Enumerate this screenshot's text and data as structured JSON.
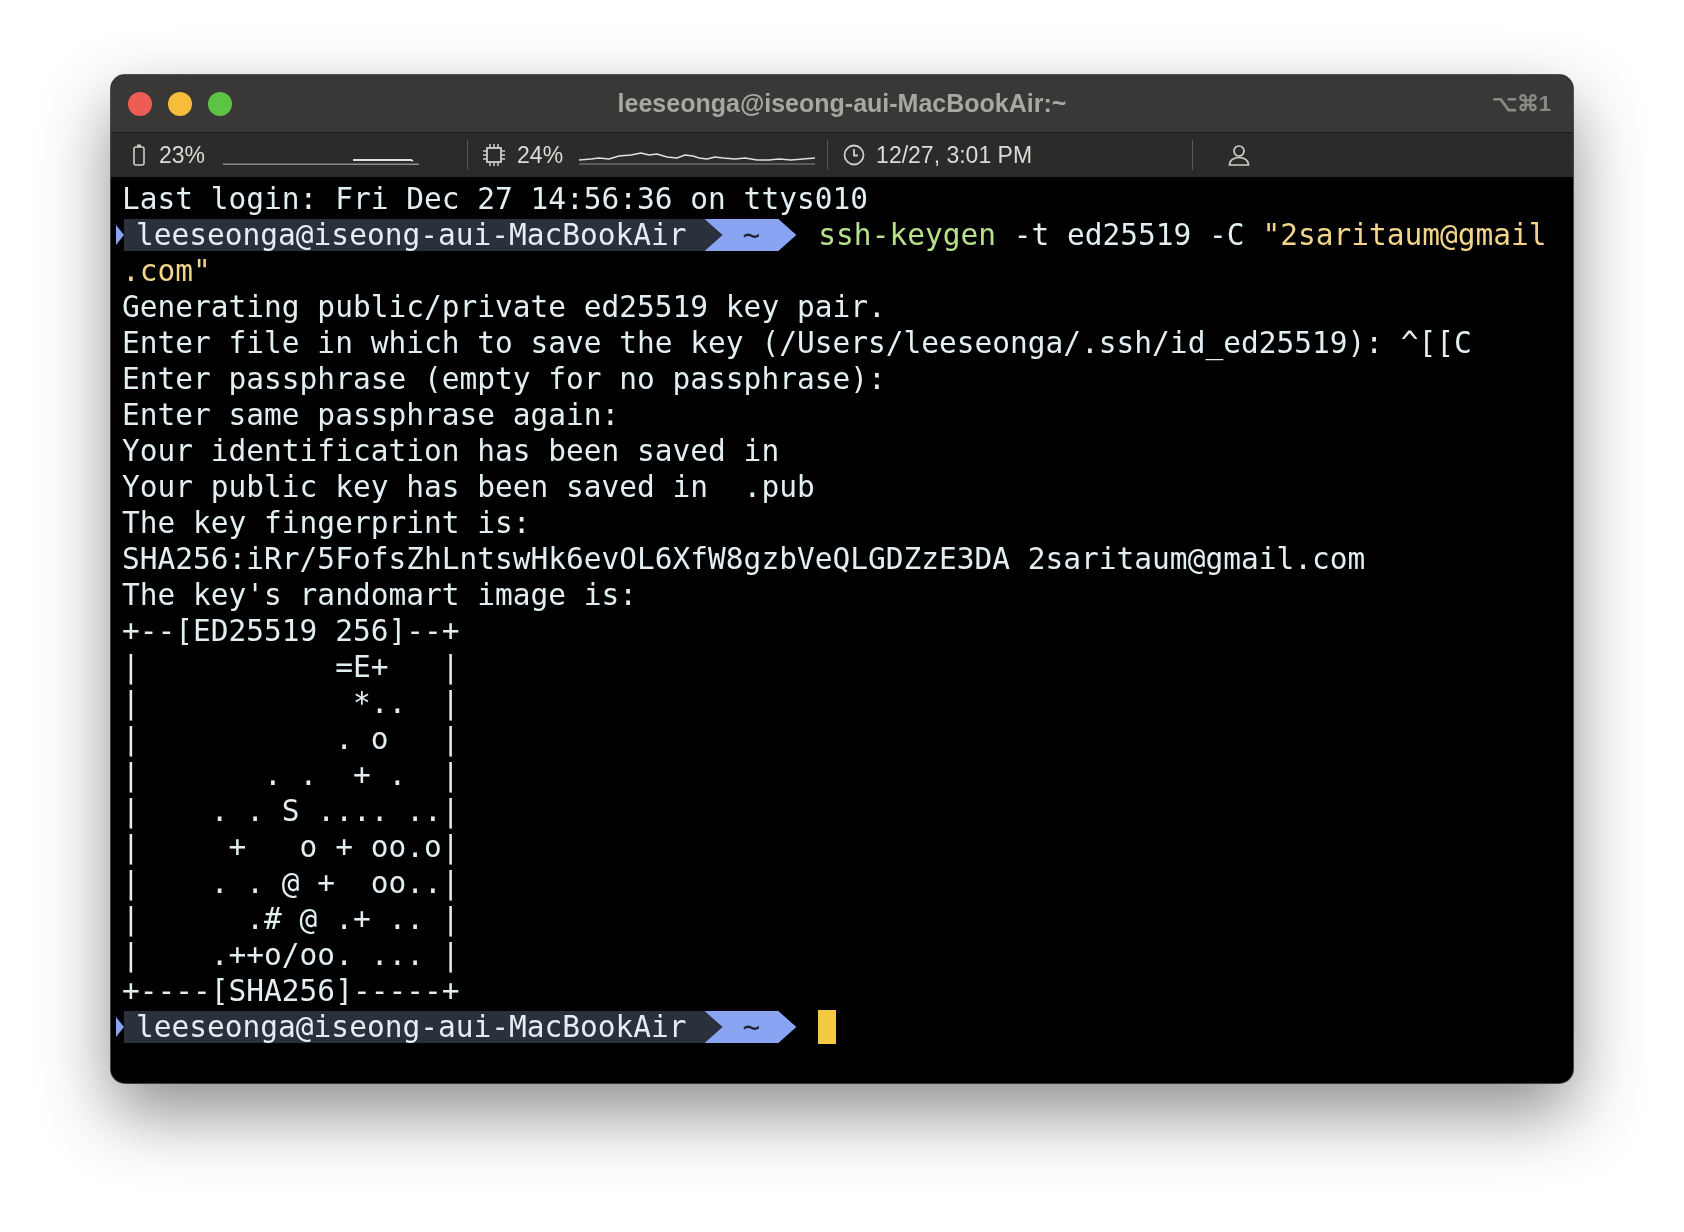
{
  "window": {
    "title": "leeseonga@iseong-aui-MacBookAir:~",
    "shortcut": "⌥⌘1"
  },
  "status_bar": {
    "battery": "23%",
    "cpu": "24%",
    "clock": "12/27, 3:01 PM"
  },
  "terminal": {
    "lines": [
      {
        "kind": "output",
        "text": "Last login: Fri Dec 27 14:56:36 on ttys010"
      },
      {
        "kind": "prompt",
        "host": "leeseonga@iseong-aui-MacBookAir",
        "dir": "~",
        "command": [
          {
            "kind": "program",
            "text": "ssh-keygen"
          },
          {
            "kind": "argument",
            "text": " -t ed25519 -C "
          },
          {
            "kind": "string",
            "text": "\"2saritaum@gmail"
          }
        ]
      },
      {
        "kind": "continuation",
        "text": ".com\""
      },
      {
        "kind": "output",
        "text": "Generating public/private ed25519 key pair."
      },
      {
        "kind": "output",
        "text": "Enter file in which to save the key (/Users/leeseonga/.ssh/id_ed25519): ^[[C"
      },
      {
        "kind": "output",
        "text": "Enter passphrase (empty for no passphrase):"
      },
      {
        "kind": "output",
        "text": "Enter same passphrase again:"
      },
      {
        "kind": "output",
        "text": "Your identification has been saved in"
      },
      {
        "kind": "output",
        "text": "Your public key has been saved in  .pub"
      },
      {
        "kind": "output",
        "text": "The key fingerprint is:"
      },
      {
        "kind": "output",
        "text": "SHA256:iRr/5FofsZhLntswHk6evOL6XfW8gzbVeQLGDZzE3DA 2saritaum@gmail.com"
      },
      {
        "kind": "output",
        "text": "The key's randomart image is:"
      },
      {
        "kind": "output",
        "text": "+--[ED25519 256]--+"
      },
      {
        "kind": "output",
        "text": "|           =E+   |"
      },
      {
        "kind": "output",
        "text": "|            *..  |"
      },
      {
        "kind": "output",
        "text": "|           . o   |"
      },
      {
        "kind": "output",
        "text": "|       . .  + .  |"
      },
      {
        "kind": "output",
        "text": "|    . . S .... ..|"
      },
      {
        "kind": "output",
        "text": "|     +   o + oo.o|"
      },
      {
        "kind": "output",
        "text": "|    . . @ +  oo..|"
      },
      {
        "kind": "output",
        "text": "|      .# @ .+ .. |"
      },
      {
        "kind": "output",
        "text": "|    .++o/oo. ... |"
      },
      {
        "kind": "output",
        "text": "+----[SHA256]-----+"
      },
      {
        "kind": "prompt",
        "host": "leeseonga@iseong-aui-MacBookAir",
        "dir": "~",
        "cursor": true
      }
    ]
  }
}
